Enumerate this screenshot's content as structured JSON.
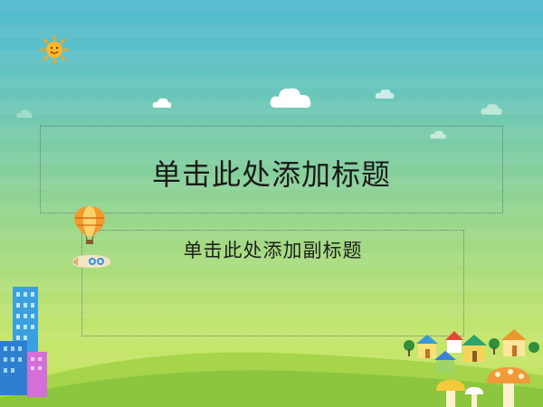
{
  "slide": {
    "title_placeholder": "单击此处添加标题",
    "subtitle_placeholder": "单击此处添加副标题"
  },
  "decorations": {
    "sun": "sun-icon",
    "clouds": "cloud-icon",
    "balloon": "hot-air-balloon-icon",
    "blimp": "blimp-icon",
    "city": "buildings-icon",
    "village": "houses-icon",
    "mushrooms": "mushroom-icon"
  },
  "colors": {
    "sky_top": "#4fbad0",
    "grass_bottom": "#bfe05c",
    "hill": "#8cc63f"
  }
}
